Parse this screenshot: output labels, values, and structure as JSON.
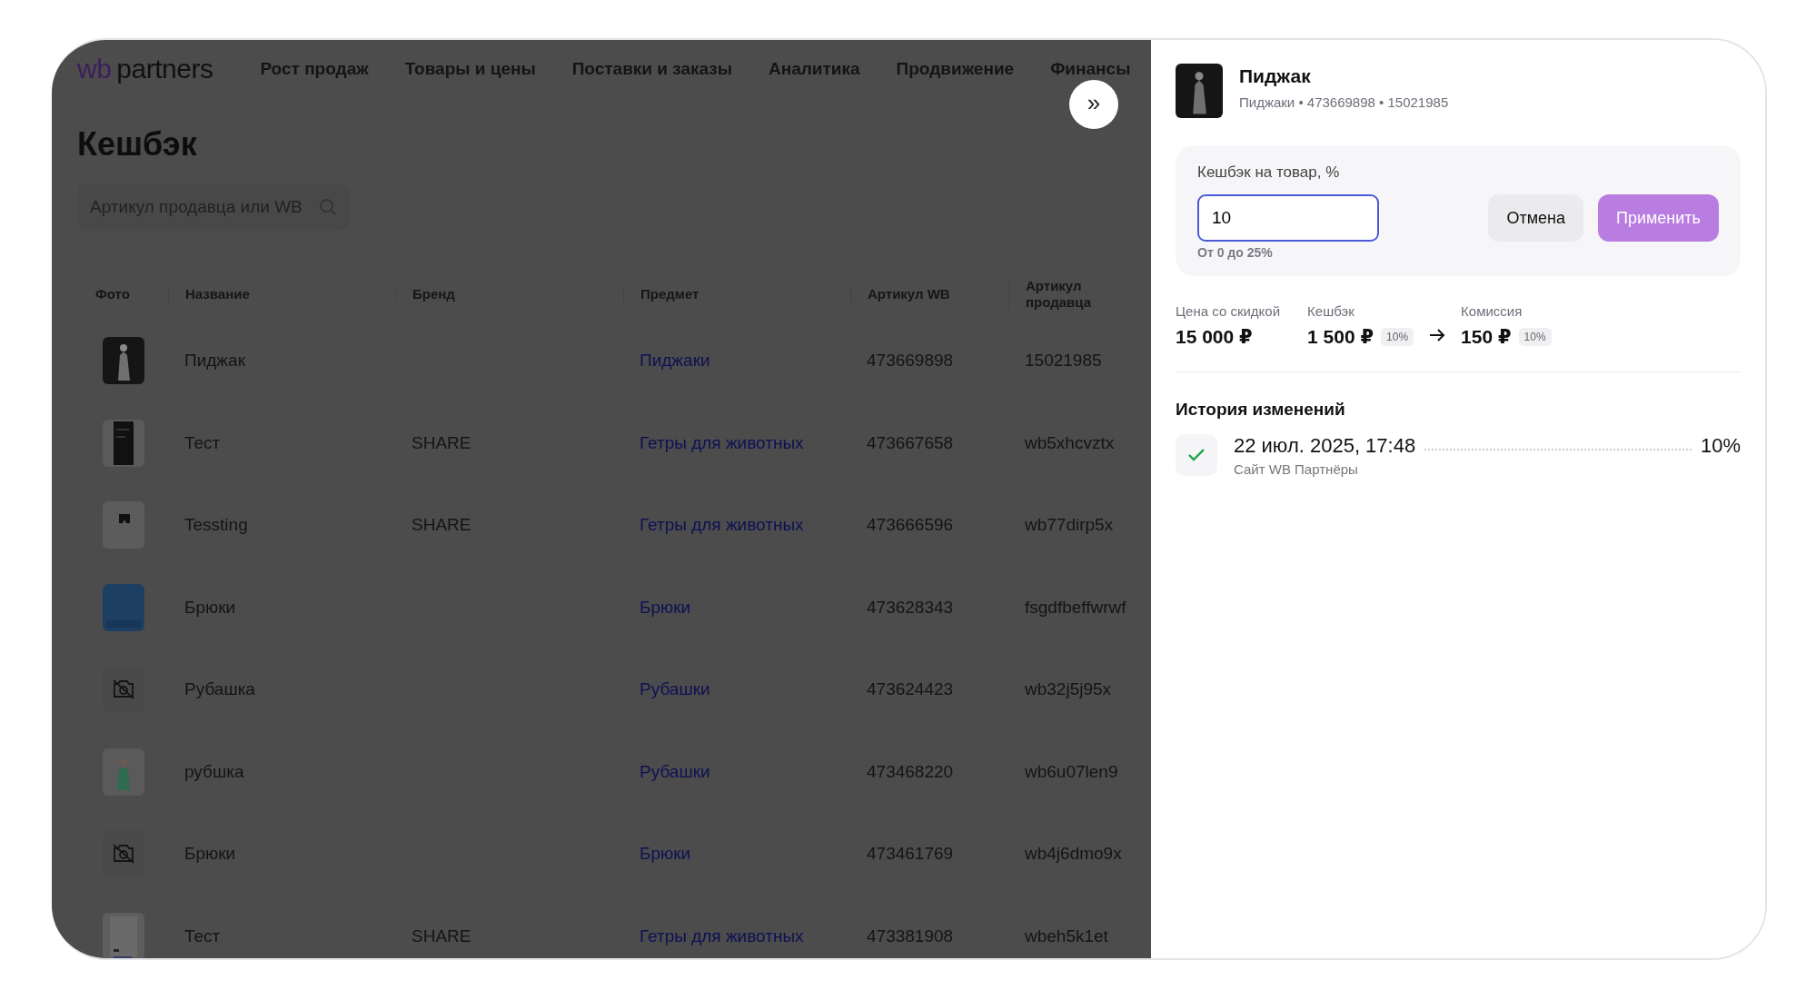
{
  "logo": {
    "mark": "wb",
    "name": "partners"
  },
  "nav": [
    "Рост продаж",
    "Товары и цены",
    "Поставки и заказы",
    "Аналитика",
    "Продвижение",
    "Финансы"
  ],
  "expand_button": {
    "label": "»"
  },
  "page_title": "Кешбэк",
  "search": {
    "placeholder": "Артикул продавца или WB"
  },
  "table": {
    "columns": [
      "Фото",
      "Название",
      "Бренд",
      "Предмет",
      "Артикул WB",
      "Артикул продавца"
    ],
    "rows": [
      {
        "name": "Пиджак",
        "subject": "Пиджаки",
        "article_wb": "473669898",
        "article_seller": "15021985"
      },
      {
        "name": "Тест",
        "brand": "SHARE",
        "subject": "Гетры для животных",
        "article_wb": "473667658",
        "article_seller": "wb5xhcvztx"
      },
      {
        "name": "Tessting",
        "brand": "SHARE",
        "subject": "Гетры для животных",
        "article_wb": "473666596",
        "article_seller": "wb77dirp5x"
      },
      {
        "name": "Брюки",
        "subject": "Брюки",
        "article_wb": "473628343",
        "article_seller": "fsgdfbeffwrwf"
      },
      {
        "photo": {
          "kind": "none"
        },
        "name": "Рубашка",
        "subject": "Рубашки",
        "article_wb": "473624423",
        "article_seller": "wb32j5j95x"
      },
      {
        "name": "рубшка",
        "subject": "Рубашки",
        "article_wb": "473468220",
        "article_seller": "wb6u07len9"
      },
      {
        "photo": {
          "kind": "none"
        },
        "name": "Брюки",
        "subject": "Брюки",
        "article_wb": "473461769",
        "article_seller": "wb4j6dmo9x"
      },
      {
        "name": "Тест",
        "brand": "SHARE",
        "subject": "Гетры для животных",
        "article_wb": "473381908",
        "article_seller": "wbeh5k1et"
      }
    ]
  },
  "panel": {
    "product": {
      "title": "Пиджак",
      "meta": "Пиджаки • 473669898 • 15021985"
    },
    "cashback_form": {
      "label": "Кешбэк на товар, %",
      "value": "10",
      "focused": true,
      "hint": "От 0 до 25%",
      "buttons": [
        {
          "label": "Отмена",
          "kind": "secondary",
          "disabled": false
        },
        {
          "label": "Применить",
          "kind": "primary",
          "disabled": true
        }
      ]
    },
    "stats": [
      {
        "label": "Цена со скидкой",
        "value": "15 000 ₽"
      },
      {
        "label": "Кешбэк",
        "value": "1 500 ₽",
        "tag": "10%"
      },
      {
        "label": "Комиссия",
        "value": "150 ₽",
        "tag": "10%"
      }
    ],
    "history": {
      "title": "История изменений",
      "entries": [
        {
          "kind": "success",
          "date": "22 июл. 2025, 17:48",
          "source": "Сайт WB Партнёры",
          "value": "10%"
        }
      ]
    }
  }
}
